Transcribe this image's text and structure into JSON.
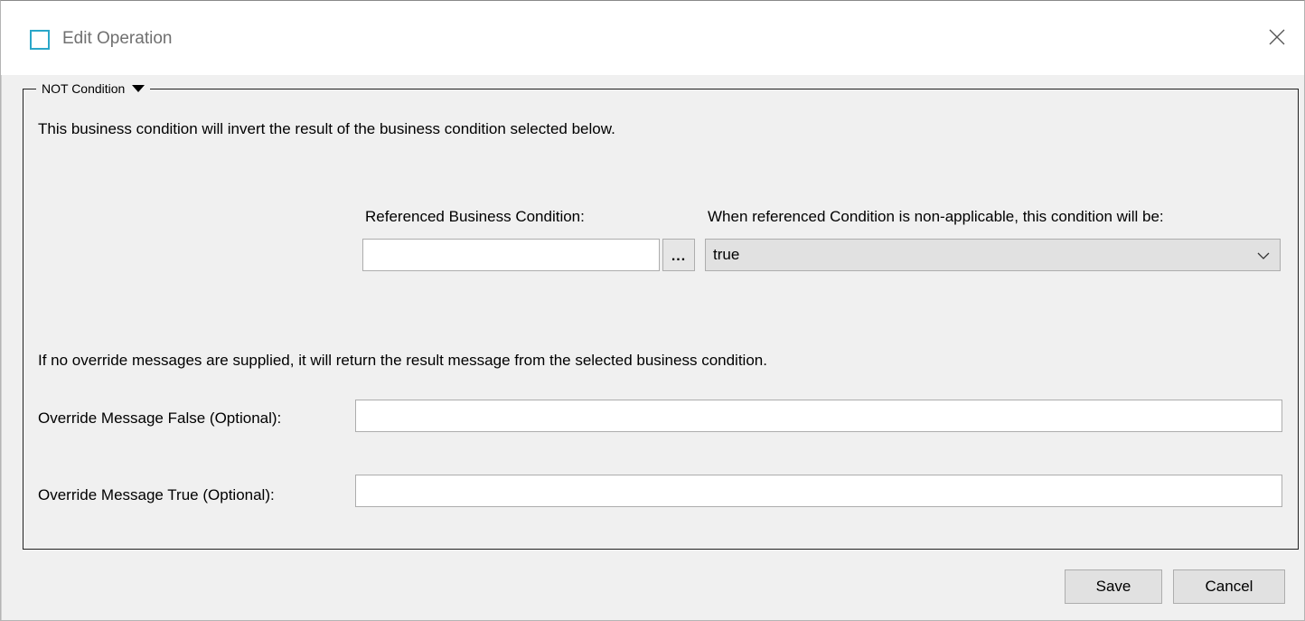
{
  "window": {
    "title": "Edit Operation",
    "icon": "window-frame-icon",
    "close_icon": "close-icon"
  },
  "group": {
    "label": "NOT Condition",
    "caret_icon": "caret-down-icon",
    "description": "This business condition will invert the result of the business condition selected below."
  },
  "referenced_condition": {
    "label": "Referenced Business Condition:",
    "value": "",
    "browse_label": "..."
  },
  "non_applicable": {
    "label": "When referenced Condition is non-applicable, this condition will be:",
    "selected": "true",
    "chevron_icon": "chevron-down-icon"
  },
  "override_note": "If no override messages are supplied, it will return the result message from the selected business condition.",
  "override_false": {
    "label": "Override Message False (Optional):",
    "value": ""
  },
  "override_true": {
    "label": "Override Message True (Optional):",
    "value": ""
  },
  "buttons": {
    "save": "Save",
    "cancel": "Cancel"
  },
  "colors": {
    "accent": "#2aa7c9",
    "background": "#f0f0f0"
  }
}
